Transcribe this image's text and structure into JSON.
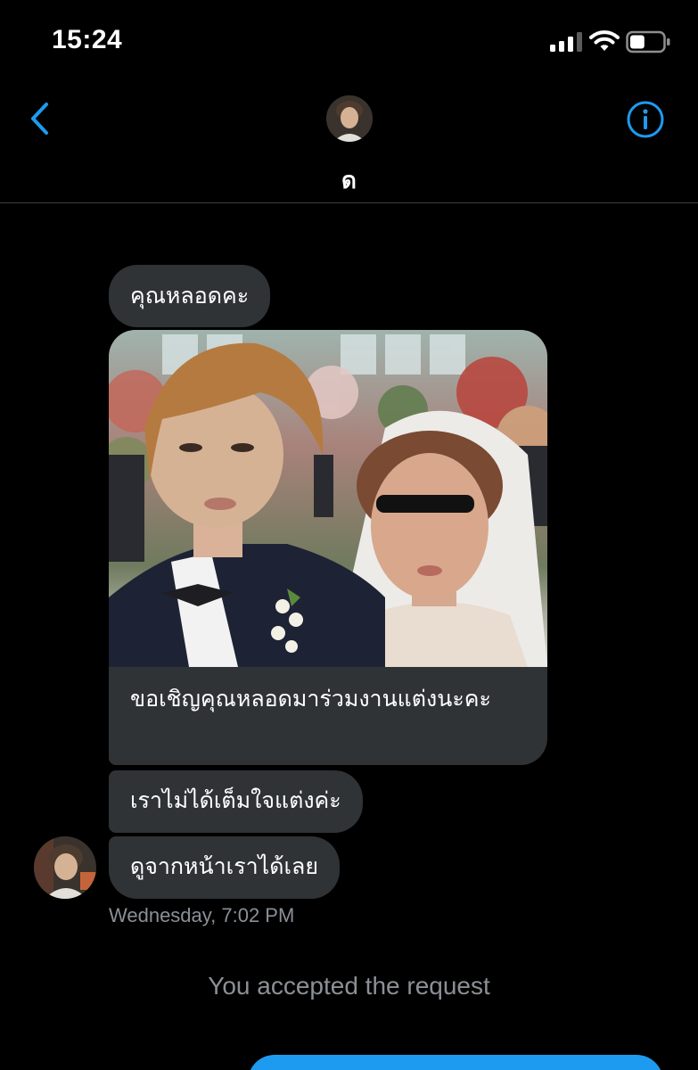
{
  "status_bar": {
    "time": "15:24",
    "icons": [
      "cellular-signal-icon",
      "wifi-icon",
      "battery-icon"
    ],
    "battery_level": 0.45
  },
  "header": {
    "back_icon": "chevron-left-icon",
    "contact_name": "ด",
    "info_icon": "info-circle-icon",
    "accent_color": "#1d9bf0"
  },
  "conversation": {
    "messages": [
      {
        "text": "คุณหลอดคะ"
      },
      {
        "media": "wedding-photo",
        "caption": "ขอเชิญคุณหลอดมาร่วมงานแต่งนะคะ"
      },
      {
        "text": "เราไม่ได้เต็มใจแต่งค่ะ"
      },
      {
        "text": "ดูจากหน้าเราได้เลย"
      }
    ],
    "timestamp": "Wednesday, 7:02 PM",
    "system_note": "You accepted the request"
  },
  "colors": {
    "background": "#000000",
    "bubble": "#2f3336",
    "secondary_text": "#8b9096",
    "divider": "#3a3d42"
  }
}
